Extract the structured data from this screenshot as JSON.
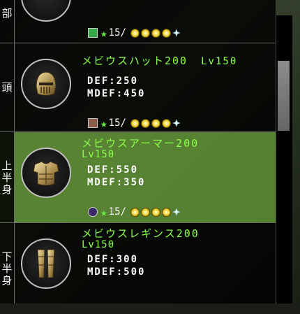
{
  "items": [
    {
      "slot_chars": [
        "部"
      ],
      "name": "",
      "level": "",
      "stats": [],
      "enhance": "15/",
      "badge_color": "#37a84a",
      "gems": 4,
      "partial": true
    },
    {
      "slot_chars": [
        "頭"
      ],
      "name": "メビウスハット200",
      "level": "Lv150",
      "stats": [
        {
          "label": "DEF",
          "value": "250"
        },
        {
          "label": "MDEF",
          "value": "450"
        }
      ],
      "enhance": "15/",
      "badge_color": "#8a5a4a",
      "gems": 4,
      "icon": "helmet-icon"
    },
    {
      "slot_chars": [
        "上",
        "半",
        "身"
      ],
      "name": "メビウスアーマー200",
      "level": "Lv150",
      "stats": [
        {
          "label": "DEF",
          "value": "550"
        },
        {
          "label": "MDEF",
          "value": "350"
        }
      ],
      "enhance": "15/",
      "badge_color": "#3a2a6a",
      "gems": 4,
      "icon": "armor-icon",
      "selected": true
    },
    {
      "slot_chars": [
        "下",
        "半",
        "身"
      ],
      "name": "メビウスレギンス200",
      "level": "Lv150",
      "stats": [
        {
          "label": "DEF",
          "value": "300"
        },
        {
          "label": "MDEF",
          "value": "500"
        }
      ],
      "icon": "leggings-icon"
    }
  ],
  "colors": {
    "name": "#8cff4a",
    "selected_row": "#5c8c34",
    "star": "#66ee44"
  }
}
